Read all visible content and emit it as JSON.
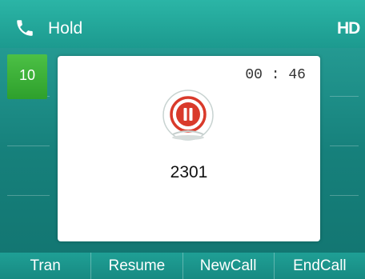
{
  "header": {
    "status": "Hold",
    "hd_label": "HD",
    "icon": "phone-icon"
  },
  "line_keys": {
    "active_label": "10"
  },
  "call": {
    "timer": "00 : 46",
    "number": "2301",
    "state_icon": "pause-icon",
    "accent_color": "#d93a2b"
  },
  "softkeys": [
    "Tran",
    "Resume",
    "NewCall",
    "EndCall"
  ],
  "colors": {
    "header": "#22ab9e",
    "line_key_active": "#3ab037"
  }
}
